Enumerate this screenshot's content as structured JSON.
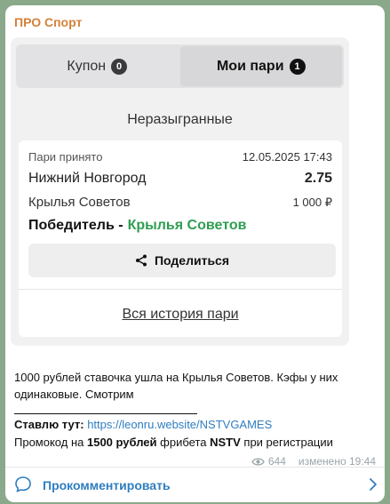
{
  "channel": {
    "name": "ПРО Спорт"
  },
  "media": {
    "tabs": [
      {
        "label": "Купон",
        "badge": "0"
      },
      {
        "label": "Мои пари",
        "badge": "1"
      }
    ],
    "section_title": "Неразыгранные",
    "bet": {
      "status": "Пари принято",
      "datetime": "12.05.2025 17:43",
      "match": "Нижний Новгород",
      "odds": "2.75",
      "team2": "Крылья Советов",
      "amount": "1 000 ₽",
      "market": "Победитель -",
      "selection": "Крылья Советов"
    },
    "share_label": "Поделиться",
    "history_label": "Вся история пари"
  },
  "text": {
    "line1": "1000 рублей ставочка ушла на Крылья Советов. Кэфы у них одинаковые. Смотрим",
    "stavlyu_label": "Ставлю тут:",
    "link": "https://leonru.website/NSTVGAMES",
    "promo_prefix": "Промокод на",
    "promo_amount": "1500 рублей",
    "promo_mid": "фрибета",
    "promo_code": "NSTV",
    "promo_suffix": "при регистрации"
  },
  "meta": {
    "views": "644",
    "edited": "изменено 19:44"
  },
  "comments": {
    "label": "Прокомментировать"
  },
  "colors": {
    "channel": "#d4813a",
    "link": "#2f7ec0",
    "win": "#2f9e52"
  }
}
